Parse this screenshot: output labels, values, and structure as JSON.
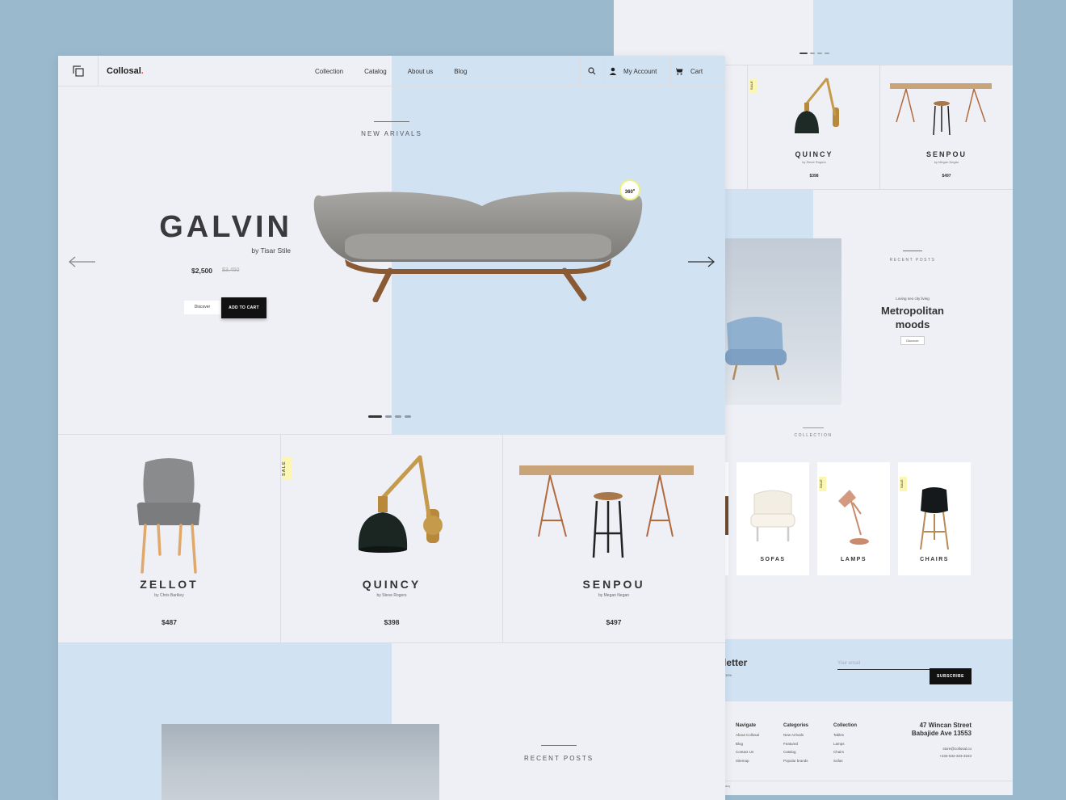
{
  "nav": {
    "brand": "Collosal",
    "brand_dot": ".",
    "menu": [
      "Collection",
      "Catalog",
      "About us",
      "Blog"
    ],
    "account": "My Account",
    "cart": "Cart"
  },
  "hero": {
    "caption": "NEW ARIVALS",
    "title": "GALVIN",
    "by": "by Tisar Stile",
    "price": "$2,500",
    "old_price": "$3,450",
    "discover": "Discover",
    "add_to_cart": "ADD TO CART",
    "badge": "360",
    "badge_sup": "o"
  },
  "products": [
    {
      "name": "ZELLOT",
      "by": "by Chris Barkley",
      "price": "$487",
      "sale": ""
    },
    {
      "name": "QUINCY",
      "by": "by Steve Rogers",
      "price": "$398",
      "sale": "SALE"
    },
    {
      "name": "SENPOU",
      "by": "by Megan Negan",
      "price": "$497",
      "sale": ""
    }
  ],
  "recent_posts_caption": "RECENT POSTS",
  "back_page": {
    "products": [
      {
        "name": "QUINCY",
        "by": "by Steve Rogers",
        "price": "$398",
        "sale": "SALE"
      },
      {
        "name": "SENPOU",
        "by": "by Megan Negan",
        "price": "$497"
      }
    ],
    "recent": {
      "caption": "RECENT POSTS",
      "sub": "Loving  neo city living",
      "title_line1": "Metropolitan",
      "title_line2": "moods",
      "discover": "Discover"
    },
    "collection_caption": "COLLECTION",
    "collection": [
      {
        "label": "SOFAS",
        "sale": ""
      },
      {
        "label": "LAMPS",
        "sale": "SALE"
      },
      {
        "label": "CHAIRS",
        "sale": "SALE"
      }
    ],
    "newsletter": {
      "title": "letter",
      "small": "10%",
      "placeholder": "Your email",
      "subscribe": "SUBSCRIBE"
    },
    "footer": {
      "navigate": {
        "heading": "Navigate",
        "items": [
          "About Collosal",
          "Blog",
          "Contact Us",
          "Sitemap"
        ]
      },
      "categories": {
        "heading": "Categories",
        "items": [
          "New Arrivals",
          "Featured",
          "Catalog",
          "Popular brands"
        ]
      },
      "collection": {
        "heading": "Collection",
        "items": [
          "Tables",
          "Lamps",
          "Chairs",
          "Sofas"
        ]
      },
      "address_line1": "47 Wincan Street",
      "address_line2": "Babajide Ave 13553",
      "email": "store@collosal.co",
      "phone": "+234-532-323-3223",
      "bottom": "acy"
    }
  },
  "colors": {
    "background": "#9bb9cd",
    "page": "#eff0f5",
    "accent_blue": "#d1e3f3",
    "sale_yellow": "#fcf6b4",
    "dark_button": "#111111",
    "brand_dot": "#e0453c"
  },
  "icons": [
    "copy-icon",
    "search-icon",
    "user-icon",
    "cart-icon",
    "arrow-left-icon",
    "arrow-right-icon"
  ]
}
